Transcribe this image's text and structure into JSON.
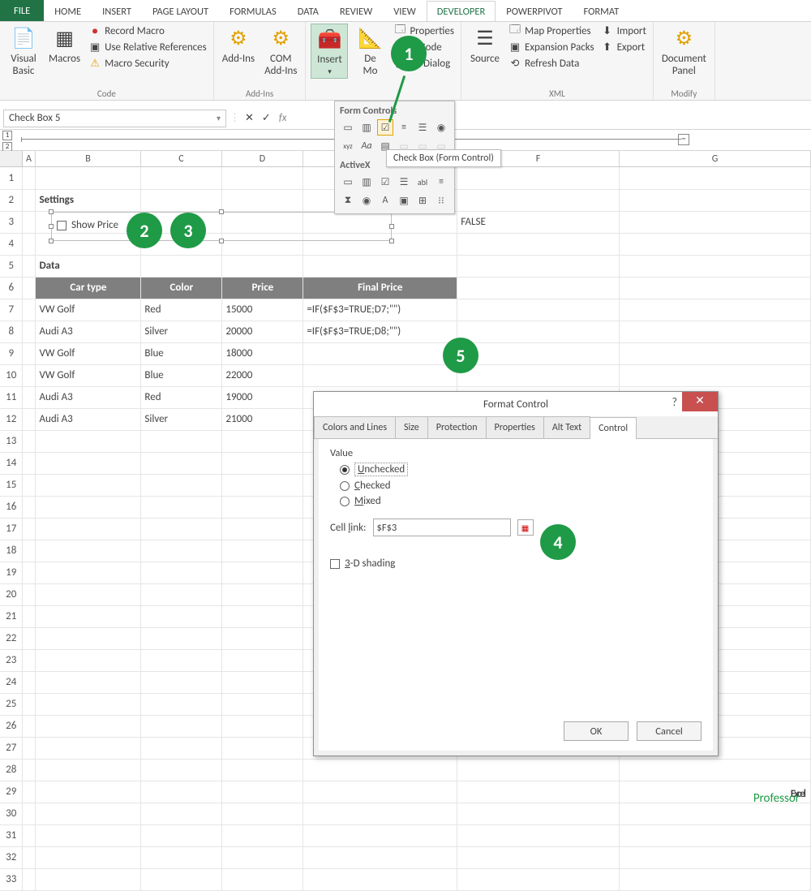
{
  "tabs": {
    "file": "FILE",
    "home": "HOME",
    "insert": "INSERT",
    "page_layout": "PAGE LAYOUT",
    "formulas": "FORMULAS",
    "data": "DATA",
    "review": "REVIEW",
    "view": "VIEW",
    "developer": "DEVELOPER",
    "powerpivot": "POWERPIVOT",
    "format": "FORMAT"
  },
  "ribbon": {
    "code": {
      "visual_basic": "Visual\nBasic",
      "macros": "Macros",
      "record": "Record Macro",
      "rel_ref": "Use Relative References",
      "security": "Macro Security",
      "label": "Code"
    },
    "addins": {
      "addins": "Add-Ins",
      "com": "COM\nAdd-Ins",
      "label": "Add-Ins"
    },
    "controls": {
      "insert": "Insert",
      "design": "De\nMo",
      "properties": "Properties",
      "view_code": "w Code",
      "run_dialog": "un Dialog",
      "label": ""
    },
    "xml": {
      "source": "Source",
      "map_props": "Map Properties",
      "expansion": "Expansion Packs",
      "refresh": "Refresh Data",
      "import": "Import",
      "export": "Export",
      "label": "XML"
    },
    "modify": {
      "doc_panel": "Document\nPanel",
      "label": "Modify"
    }
  },
  "namebox": "Check Box 5",
  "insert_panel": {
    "form": "Form Controls",
    "activex": "ActiveX"
  },
  "tooltip": "Check Box (Form Control)",
  "sheet": {
    "settings_hdr": "Settings",
    "show_price": "Show Price",
    "f3": "FALSE",
    "data_hdr": "Data",
    "cols": {
      "car": "Car type",
      "color": "Color",
      "price": "Price",
      "final": "Final Price"
    },
    "rows": [
      {
        "car": "VW Golf",
        "color": "Red",
        "price": "15000",
        "final": "=IF($F$3=TRUE;D7;\"\")"
      },
      {
        "car": "Audi A3",
        "color": "Silver",
        "price": "20000",
        "final": "=IF($F$3=TRUE;D8;\"\")"
      },
      {
        "car": "VW Golf",
        "color": "Blue",
        "price": "18000",
        "final": ""
      },
      {
        "car": "VW Golf",
        "color": "Blue",
        "price": "22000",
        "final": ""
      },
      {
        "car": "Audi A3",
        "color": "Red",
        "price": "19000",
        "final": ""
      },
      {
        "car": "Audi A3",
        "color": "Silver",
        "price": "21000",
        "final": ""
      }
    ]
  },
  "dialog": {
    "title": "Format Control",
    "tabs": {
      "colors": "Colors and Lines",
      "size": "Size",
      "protection": "Protection",
      "properties": "Properties",
      "alt": "Alt Text",
      "control": "Control"
    },
    "value_lbl": "Value",
    "unchecked": "Unchecked",
    "checked": "Checked",
    "mixed": "Mixed",
    "cell_link_lbl": "Cell link:",
    "cell_link": "$F$3",
    "shading": "3-D shading",
    "ok": "OK",
    "cancel": "Cancel"
  },
  "badges": {
    "b1": "1",
    "b2": "2",
    "b3": "3",
    "b4": "4",
    "b5": "5"
  },
  "logo": {
    "main": "Excel",
    "sub": "Professor"
  }
}
